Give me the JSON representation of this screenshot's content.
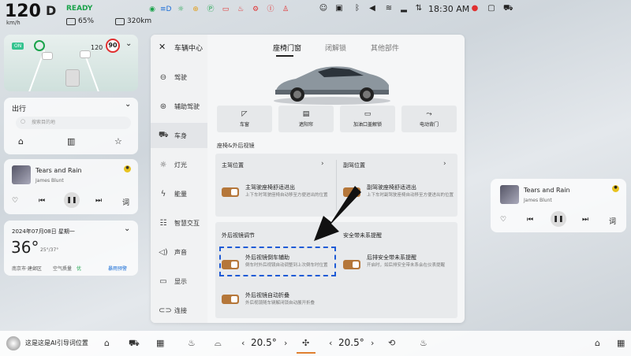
{
  "status": {
    "speed": "120",
    "speed_unit": "km/h",
    "gear": "D",
    "ready": "READY",
    "battery": "65%",
    "range": "320km",
    "time": "18:30 AM"
  },
  "adas": {
    "speed_limit": "90",
    "current_speed": "120"
  },
  "nav": {
    "title": "出行",
    "search_placeholder": "搜索目的地"
  },
  "music": {
    "title": "Tears and Rain",
    "artist": "James Blunt"
  },
  "weather": {
    "date": "2024年07月08日 星期一",
    "temp": "36°",
    "range": "25°/37°",
    "location": "南京市·建邺区",
    "air_label": "空气质量",
    "air_value": "优",
    "alert": "暴雨预警"
  },
  "dialog": {
    "title": "车辆中心",
    "sidebar": [
      {
        "label": "驾驶",
        "icon": "steering-icon"
      },
      {
        "label": "辅助驾驶",
        "icon": "assist-icon"
      },
      {
        "label": "车身",
        "icon": "car-body-icon"
      },
      {
        "label": "灯光",
        "icon": "light-icon"
      },
      {
        "label": "能量",
        "icon": "energy-icon"
      },
      {
        "label": "智慧交互",
        "icon": "smart-icon"
      },
      {
        "label": "声音",
        "icon": "sound-icon"
      },
      {
        "label": "显示",
        "icon": "display-icon"
      },
      {
        "label": "连接",
        "icon": "link-icon"
      }
    ],
    "tabs": [
      "座椅门窗",
      "闭解锁",
      "其他部件"
    ],
    "tiles": [
      "车窗",
      "遮阳帘",
      "加油口盖解锁",
      "电动背门"
    ],
    "section1": "座椅&外后视镜",
    "driver_pos": "主驾位置",
    "pass_pos": "副驾位置",
    "driver_seat": {
      "title": "主驾驶座椅舒适进出",
      "sub": "上下车时驾驶座椅自动移至方便进出的位置"
    },
    "pass_seat": {
      "title": "副驾驶座椅舒适进出",
      "sub": "上下车时副驾驶座椅自动移至方便进出的位置"
    },
    "mirror_section": "外后视镜调节",
    "belt_section": "安全带未系提醒",
    "mirror_assist": {
      "title": "外后视镜倒车辅助",
      "sub": "倒车时外后视镜自动调整到上次倒车时位置"
    },
    "belt_remind": {
      "title": "后排安全带未系提醒",
      "sub": "开启时，如后排安全带未系会在仪表提醒"
    },
    "mirror_fold": {
      "title": "外后视镜自动折叠",
      "sub": "外后视镜随车辆解闭锁自动展开折叠"
    }
  },
  "bottom": {
    "assistant": "这是这是AI引导词位置",
    "temp_left": "20.5°",
    "temp_right": "20.5°"
  }
}
